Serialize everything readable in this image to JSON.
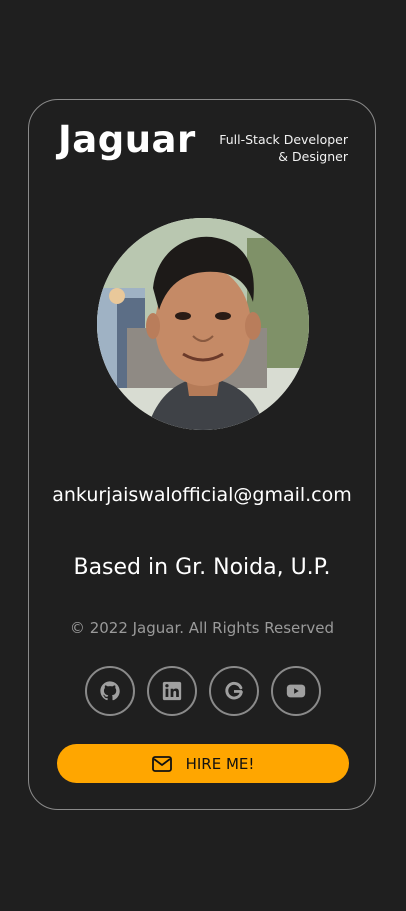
{
  "brand": {
    "name": "Jaguar"
  },
  "header": {
    "role_line1": "Full-Stack Developer",
    "role_line2": "& Designer"
  },
  "profile": {
    "email": "ankurjaiswalofficial@gmail.com",
    "location": "Based in Gr. Noida, U.P."
  },
  "footer": {
    "copyright": "© 2022 Jaguar. All Rights Reserved"
  },
  "socials": [
    {
      "icon": "github-icon"
    },
    {
      "icon": "linkedin-icon"
    },
    {
      "icon": "google-icon"
    },
    {
      "icon": "youtube-icon"
    }
  ],
  "cta": {
    "label": "HIRE ME!",
    "icon": "mail-icon"
  },
  "colors": {
    "background": "#1f1f1f",
    "accent": "#ffa600",
    "border": "#8a8a8a",
    "muted": "#9a9a9a"
  }
}
